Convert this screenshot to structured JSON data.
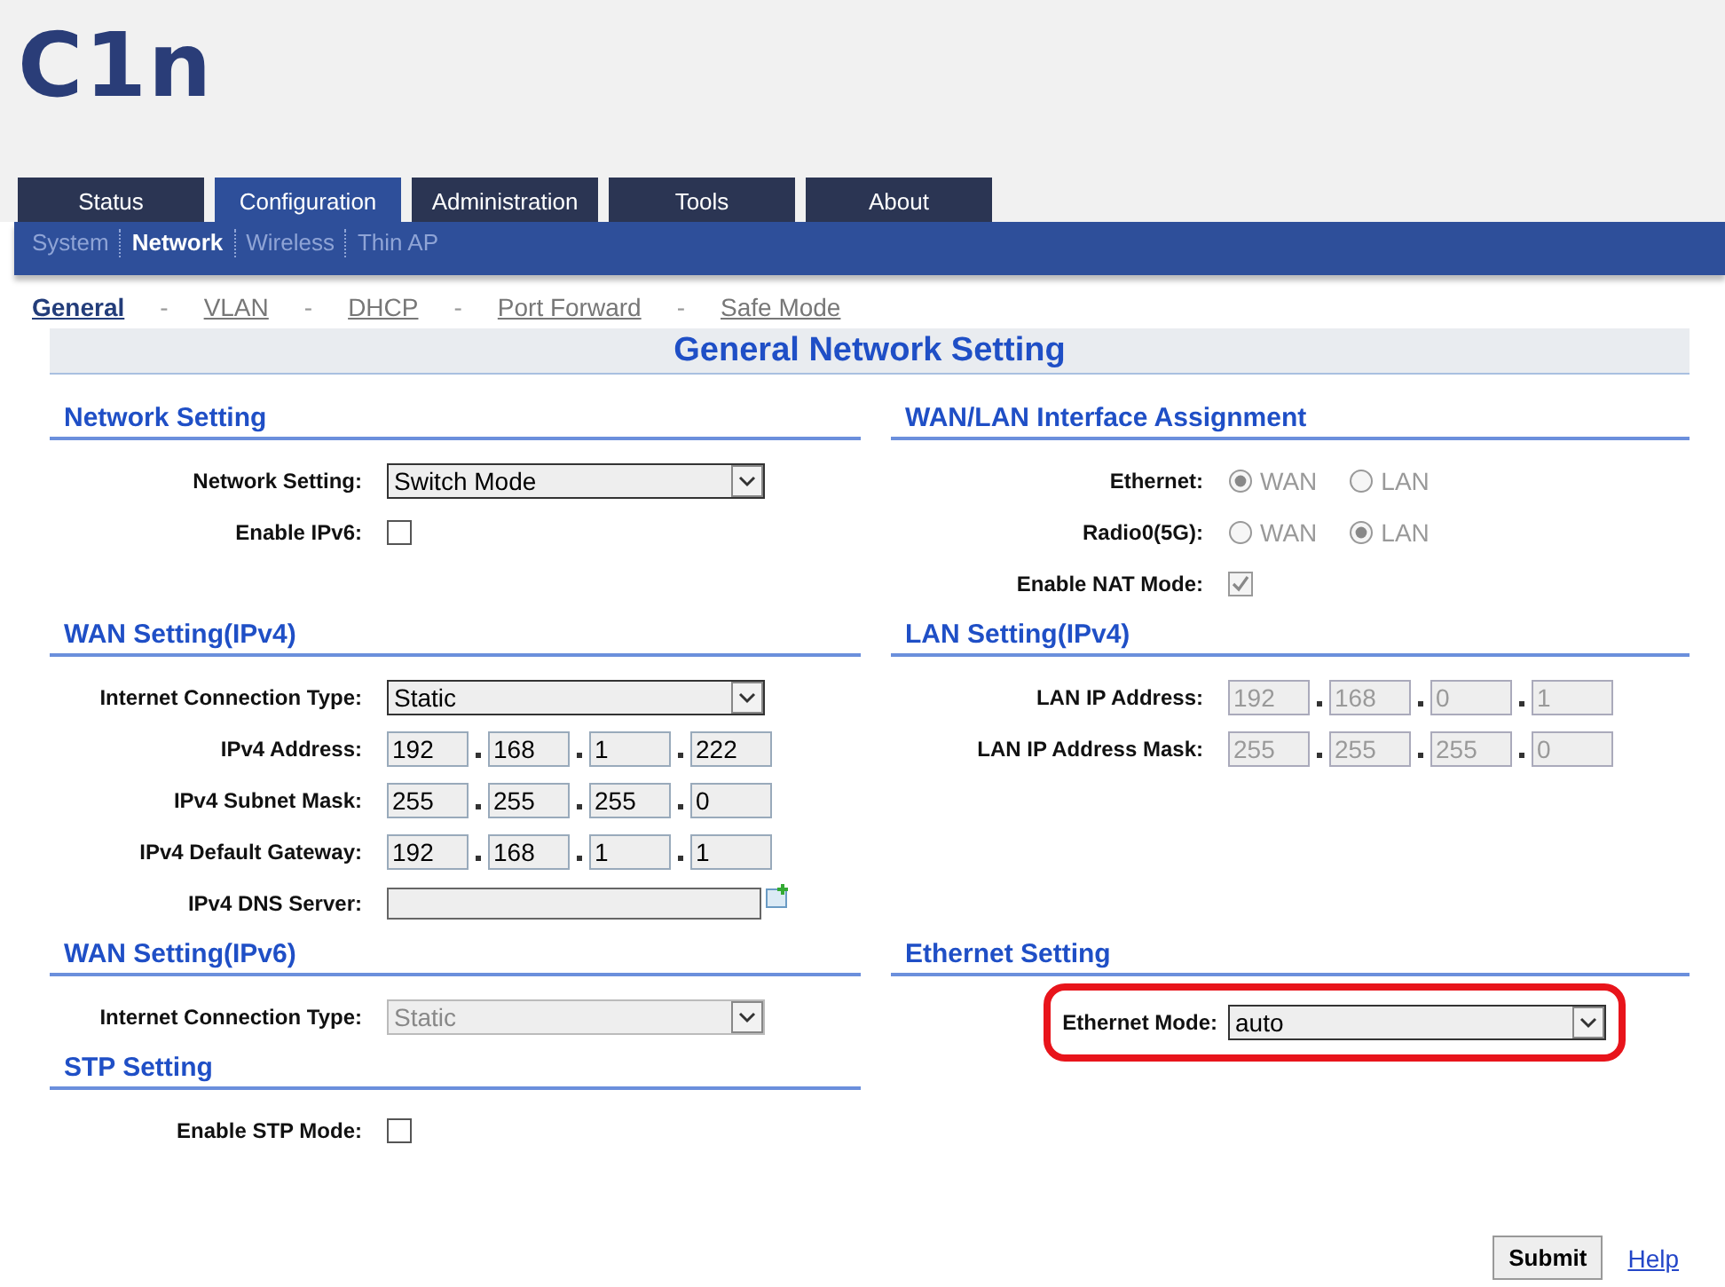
{
  "logo": "C1n",
  "tabs": [
    {
      "label": "Status",
      "selected": false
    },
    {
      "label": "Configuration",
      "selected": true
    },
    {
      "label": "Administration",
      "selected": false
    },
    {
      "label": "Tools",
      "selected": false
    },
    {
      "label": "About",
      "selected": false
    }
  ],
  "subnav": [
    {
      "label": "System",
      "selected": false
    },
    {
      "label": "Network",
      "selected": true
    },
    {
      "label": "Wireless",
      "selected": false
    },
    {
      "label": "Thin AP",
      "selected": false
    }
  ],
  "page_nav": [
    {
      "kind": "link",
      "label": "General",
      "selected": true
    },
    {
      "kind": "separator",
      "label": "-"
    },
    {
      "kind": "link",
      "label": "VLAN",
      "selected": false
    },
    {
      "kind": "separator",
      "label": "-"
    },
    {
      "kind": "link",
      "label": "DHCP",
      "selected": false
    },
    {
      "kind": "separator",
      "label": "-"
    },
    {
      "kind": "link",
      "label": "Port Forward",
      "selected": false
    },
    {
      "kind": "separator",
      "label": "-"
    },
    {
      "kind": "link",
      "label": "Safe Mode",
      "selected": false
    }
  ],
  "title": "General Network Setting",
  "section_rows": [
    {
      "left": [
        {
          "title": "Network Setting",
          "rows": [
            {
              "kind": "select",
              "label": "Network Setting:",
              "value": "Switch Mode",
              "disabled": false,
              "highlighted": false
            },
            {
              "kind": "checkbox",
              "label": "Enable IPv6:",
              "checked": false,
              "disabled": false,
              "highlighted": false
            }
          ]
        }
      ],
      "right": [
        {
          "title": "WAN/LAN Interface Assignment",
          "rows": [
            {
              "kind": "radio",
              "label": "Ethernet:",
              "disabled": true,
              "highlighted": false,
              "options": [
                {
                  "label": "WAN",
                  "selected": true
                },
                {
                  "label": "LAN",
                  "selected": false
                }
              ]
            },
            {
              "kind": "radio",
              "label": "Radio0(5G):",
              "disabled": true,
              "highlighted": false,
              "options": [
                {
                  "label": "WAN",
                  "selected": false
                },
                {
                  "label": "LAN",
                  "selected": true
                }
              ]
            },
            {
              "kind": "checkbox",
              "label": "Enable NAT Mode:",
              "checked": true,
              "disabled": true,
              "highlighted": false
            }
          ]
        }
      ]
    },
    {
      "left": [
        {
          "title": "WAN Setting(IPv4)",
          "rows": [
            {
              "kind": "select",
              "label": "Internet Connection Type:",
              "value": "Static",
              "disabled": false,
              "highlighted": false
            },
            {
              "kind": "ip",
              "label": "IPv4 Address:",
              "octets": [
                "192",
                "168",
                "1",
                "222"
              ],
              "disabled": false,
              "highlighted": false
            },
            {
              "kind": "ip",
              "label": "IPv4 Subnet Mask:",
              "octets": [
                "255",
                "255",
                "255",
                "0"
              ],
              "disabled": false,
              "highlighted": false
            },
            {
              "kind": "ip",
              "label": "IPv4 Default Gateway:",
              "octets": [
                "192",
                "168",
                "1",
                "1"
              ],
              "disabled": false,
              "highlighted": false
            },
            {
              "kind": "text",
              "label": "IPv4 DNS Server:",
              "highlighted": false
            }
          ]
        }
      ],
      "right": [
        {
          "title": "LAN Setting(IPv4)",
          "rows": [
            {
              "kind": "ip",
              "label": "LAN IP Address:",
              "octets": [
                "192",
                "168",
                "0",
                "1"
              ],
              "disabled": true,
              "highlighted": false
            },
            {
              "kind": "ip",
              "label": "LAN IP Address Mask:",
              "octets": [
                "255",
                "255",
                "255",
                "0"
              ],
              "disabled": true,
              "highlighted": false
            }
          ]
        }
      ]
    },
    {
      "left": [
        {
          "title": "WAN Setting(IPv6)",
          "rows": [
            {
              "kind": "select",
              "label": "Internet Connection Type:",
              "value": "Static",
              "disabled": true,
              "highlighted": false
            }
          ]
        },
        {
          "title": "STP Setting",
          "rows": [
            {
              "kind": "checkbox",
              "label": "Enable STP Mode:",
              "checked": false,
              "disabled": false,
              "highlighted": false
            }
          ]
        }
      ],
      "right": [
        {
          "title": "Ethernet Setting",
          "rows": [
            {
              "kind": "select",
              "label": "Ethernet Mode:",
              "value": "auto",
              "disabled": false,
              "highlighted": true
            }
          ]
        }
      ]
    }
  ],
  "submit": "Submit",
  "help": "Help"
}
